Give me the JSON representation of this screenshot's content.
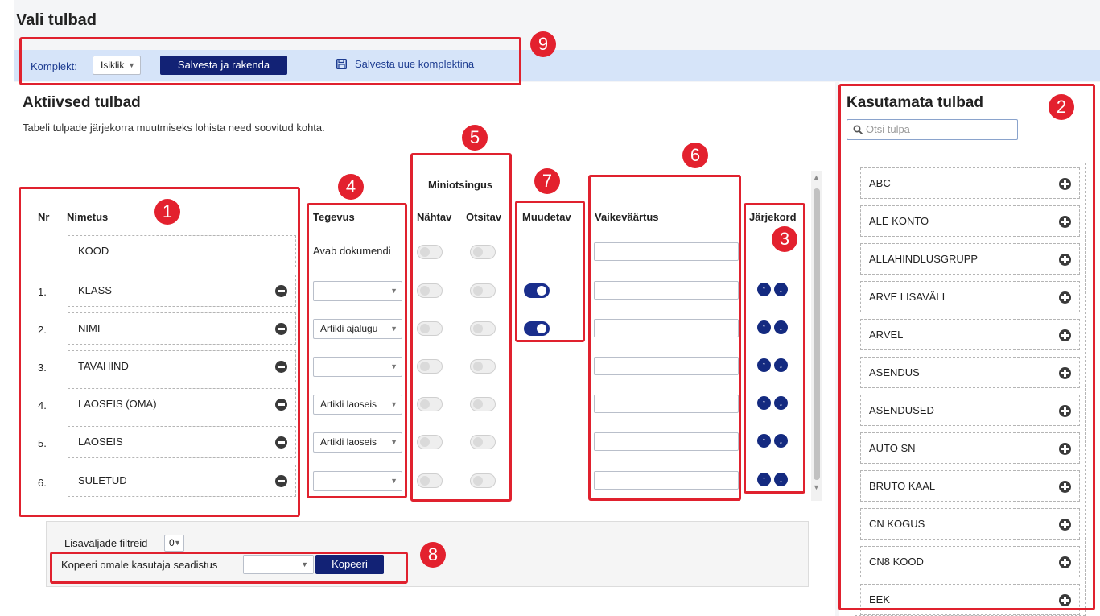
{
  "page": {
    "title": "Vali tulbad"
  },
  "toolbar": {
    "set_label": "Komplekt:",
    "set_value": "Isiklik",
    "save_apply": "Salvesta ja rakenda",
    "save_new": "Salvesta uue komplektina"
  },
  "active": {
    "title": "Aktiivsed tulbad",
    "hint": "Tabeli tulpade järjekorra muutmiseks lohista need soovitud kohta.",
    "headers": {
      "nr": "Nr",
      "name": "Nimetus",
      "action": "Tegevus",
      "minisearch": "Miniotsingus",
      "visible": "Nähtav",
      "searchable": "Otsitav",
      "editable": "Muudetav",
      "default": "Vaikeväärtus",
      "order": "Järjekord"
    },
    "fixed_row": {
      "name": "KOOD",
      "action": "Avab dokumendi"
    },
    "rows": [
      {
        "nr": "1.",
        "name": "KLASS",
        "action": "",
        "editable": true
      },
      {
        "nr": "2.",
        "name": "NIMI",
        "action": "Artikli ajalugu",
        "editable": true
      },
      {
        "nr": "3.",
        "name": "TAVAHIND",
        "action": "",
        "editable": false
      },
      {
        "nr": "4.",
        "name": "LAOSEIS (OMA)",
        "action": "Artikli laoseis",
        "editable": false
      },
      {
        "nr": "5.",
        "name": "LAOSEIS",
        "action": "Artikli laoseis",
        "editable": false
      },
      {
        "nr": "6.",
        "name": "SULETUD",
        "action": "",
        "editable": false
      }
    ]
  },
  "filters": {
    "extra_label": "Lisaväljade filtreid",
    "extra_value": "0",
    "copy_label": "Kopeeri omale kasutaja seadistus",
    "copy_button": "Kopeeri"
  },
  "unused": {
    "title": "Kasutamata tulbad",
    "search_placeholder": "Otsi tulpa",
    "items": [
      "ABC",
      "ALE KONTO",
      "ALLAHINDLUSGRUPP",
      "ARVE LISAVÄLI",
      "ARVEL",
      "ASENDUS",
      "ASENDUSED",
      "AUTO SN",
      "BRUTO KAAL",
      "CN KOGUS",
      "CN8 KOOD",
      "EEK"
    ]
  },
  "callouts": [
    "1",
    "2",
    "3",
    "4",
    "5",
    "6",
    "7",
    "8",
    "9"
  ],
  "colors": {
    "accent": "#122275",
    "toolbar_bg": "#d6e4f9",
    "callout": "#e3212e"
  }
}
